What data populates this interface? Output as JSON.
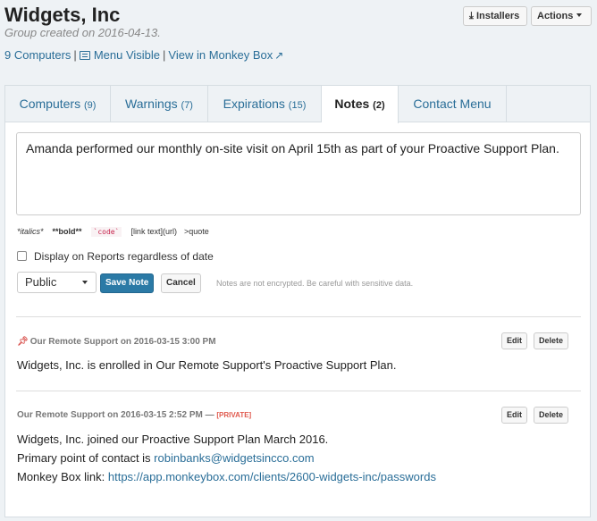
{
  "header": {
    "title": "Widgets, Inc",
    "subtitle": "Group created on 2016-04-13.",
    "links": {
      "computers": "9 Computers",
      "menu_visible": "Menu Visible",
      "monkey_box": "View in Monkey Box"
    },
    "installers_label": "Installers",
    "actions_label": "Actions"
  },
  "tabs": [
    {
      "label": "Computers",
      "count": "(9)"
    },
    {
      "label": "Warnings",
      "count": "(7)"
    },
    {
      "label": "Expirations",
      "count": "(15)"
    },
    {
      "label": "Notes",
      "count": "(2)",
      "active": true
    },
    {
      "label": "Contact Menu",
      "count": ""
    }
  ],
  "editor": {
    "text": "Amanda performed our monthly on-site visit on April 15th as part of your Proactive Support Plan.",
    "hints": {
      "italics": "*italics*",
      "bold": "**bold**",
      "code": "`code`",
      "link": "[link text](url)",
      "quote": ">quote"
    },
    "display_checkbox_label": "Display on Reports regardless of date",
    "visibility": "Public",
    "save_label": "Save Note",
    "cancel_label": "Cancel",
    "encryption_notice": "Notes are not encrypted. Be careful with sensitive data."
  },
  "notes": [
    {
      "meta": "Our Remote Support on 2016-03-15 3:00 PM",
      "pinned": true,
      "private_tag": "",
      "lines": [
        "Widgets, Inc. is enrolled in Our Remote Support's Proactive Support Plan."
      ],
      "edit_label": "Edit",
      "delete_label": "Delete"
    },
    {
      "meta": "Our Remote Support on 2016-03-15 2:52 PM — ",
      "pinned": false,
      "private_tag": "[PRIVATE]",
      "line1": "Widgets, Inc. joined our Proactive Support Plan March 2016.",
      "line2_prefix": "Primary point of contact is ",
      "line2_link": "robinbanks@widgetsincco.com",
      "line3_prefix": "Monkey Box link: ",
      "line3_link": "https://app.monkeybox.com/clients/2600-widgets-inc/passwords",
      "edit_label": "Edit",
      "delete_label": "Delete"
    }
  ],
  "colors": {
    "link": "#2a6e98",
    "primary_button": "#2b7aa6",
    "private": "#e05a4e",
    "pin": "#d9534f"
  }
}
